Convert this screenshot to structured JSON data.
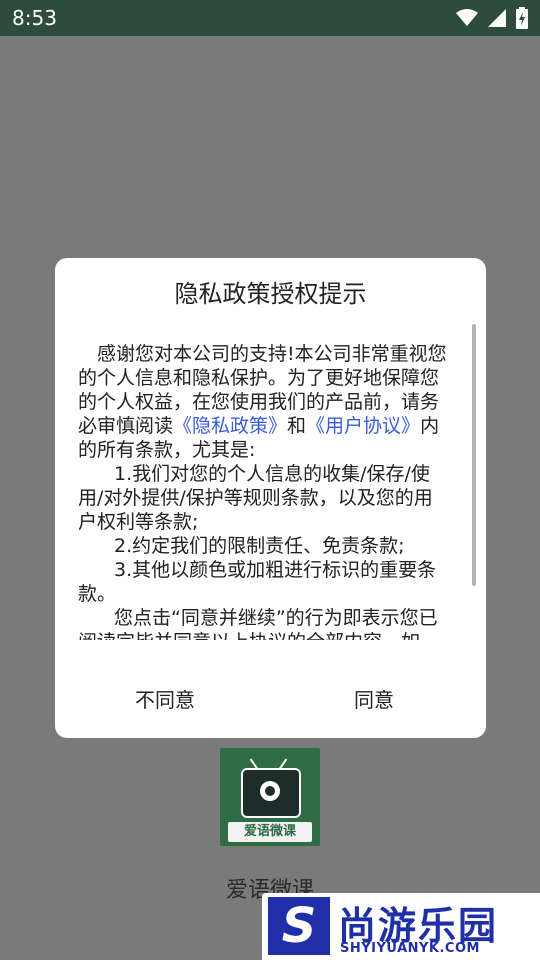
{
  "status_bar": {
    "time": "8:53"
  },
  "dialog": {
    "title": "隐私政策授权提示",
    "intro_a": "感谢您对本公司的支持!本公司非常重视您的个人信息和隐私保护。为了更好地保障您的个人权益，在您使用我们的产品前，请务必审慎阅读",
    "link_privacy": "《隐私政策》",
    "and": "和",
    "link_user": "《用户协议》",
    "intro_b": "内的所有条款，尤其是:",
    "item1": "1.我们对您的个人信息的收集/保存/使用/对外提供/保护等规则条款，以及您的用户权利等条款;",
    "item2": "2.约定我们的限制责任、免责条款;",
    "item3": "3.其他以颜色或加粗进行标识的重要条款。",
    "outro": "您点击“同意并继续”的行为即表示您已阅读完毕并同意以上协议的全部内容。如",
    "disagree_label": "不同意",
    "agree_label": "同意"
  },
  "app": {
    "logo_text": "爱语微课",
    "name": "爱语微课"
  },
  "watermark": {
    "letter": "S",
    "brand": "尚游乐园",
    "domain": "SHYIYUANYK.COM"
  },
  "colors": {
    "status_bar": "#2e4c3e",
    "link": "#3b5bdb",
    "overlay": "#7a7a7a",
    "logo_bg": "#2f6b45",
    "watermark": "#1e2fa8"
  }
}
